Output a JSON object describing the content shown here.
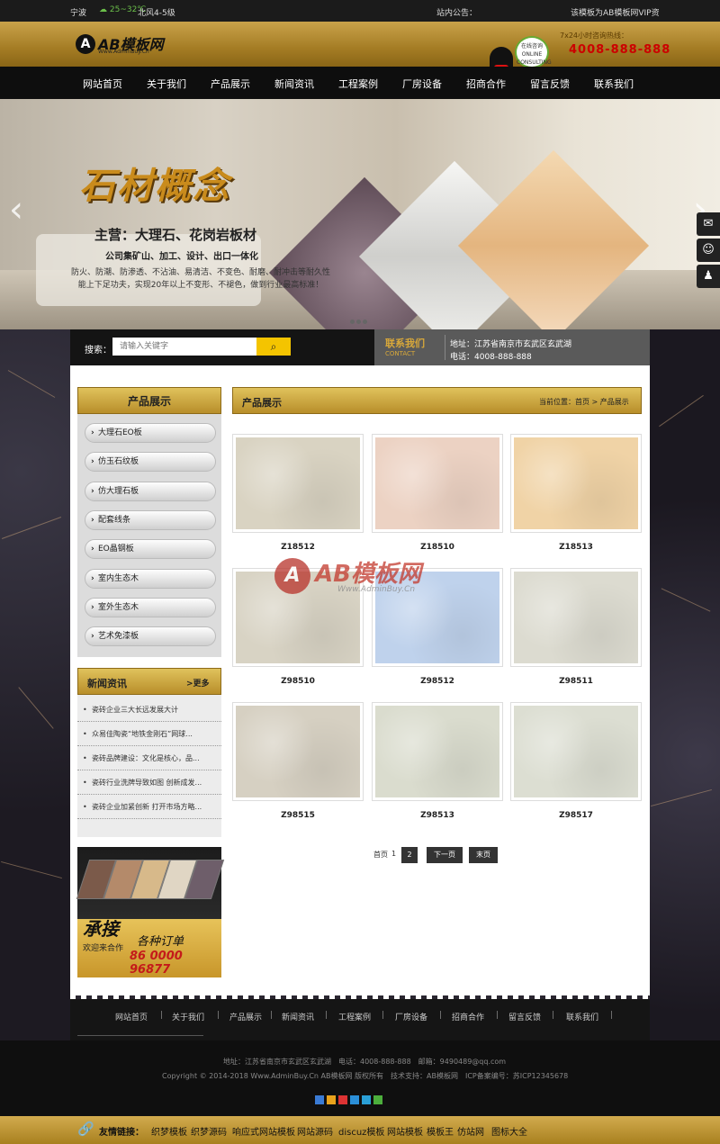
{
  "topbar": {
    "weixin": "宁波",
    "weather": "北风4-5级",
    "notice_label": "站内公告：",
    "notice_text": "该模板为AB模板网VIP资"
  },
  "header": {
    "logo_title": "AB模板网",
    "logo_sub": "Www.AdminBuy.Cn",
    "qq_bubble": "在线咨询 ONLINE CONSULTING",
    "hotline_label": "7x24小时咨询热线：",
    "hotline": "4008-888-888"
  },
  "nav": [
    "网站首页",
    "关于我们",
    "产品展示",
    "新闻资讯",
    "工程案例",
    "厂房设备",
    "招商合作",
    "留言反馈",
    "联系我们"
  ],
  "banner": {
    "title": "石材概念",
    "line1": "主营：大理石、花岗岩板材",
    "line2": "公司集矿山、加工、设计、出口一体化",
    "line3": "防火、防潮、防渗透、不沾油、易清洁、不变色、耐磨、耐冲击等耐久性能上下足功夫，实现20年以上不变形、不褪色，做到行业最高标准！"
  },
  "search": {
    "label": "搜索：",
    "placeholder": "请输入关键字"
  },
  "contact": {
    "title": "联系我们",
    "title_en": "CONTACT",
    "address": "地址：江苏省南京市玄武区玄武湖",
    "phone": "电话：4008-888-888"
  },
  "sidebar": {
    "products_title": "产品展示",
    "items": [
      "大理石EO板",
      "仿玉石纹板",
      "仿大理石板",
      "配套线条",
      "EO晶钢板",
      "室内生态木",
      "室外生态木",
      "艺术免漆板"
    ],
    "news_title": "新闻资讯",
    "news_more": ">更多",
    "news": [
      "瓷砖企业三大长远发展大计",
      "众易佳陶瓷“地铁金刚石”网球...",
      "瓷砖品牌建设：文化是核心，品...",
      "瓷砖行业洗牌导致如图 创新成发...",
      "瓷砖企业加紧创新 打开市场方略..."
    ],
    "ad": {
      "big": "承接",
      "small": "各种订单",
      "welcome": "欢迎来合作",
      "phone": "86 0000 96877"
    }
  },
  "content": {
    "title": "产品展示",
    "crumb": "当前位置：首页 > 产品展示",
    "products": [
      {
        "name": "Z18512",
        "color": "#d9d3c2"
      },
      {
        "name": "Z18510",
        "color": "#ecd2c3"
      },
      {
        "name": "Z18513",
        "color": "#f0d3a6"
      },
      {
        "name": "Z98510",
        "color": "#d8d3c4"
      },
      {
        "name": "Z98512",
        "color": "#bfd2ec"
      },
      {
        "name": "Z98511",
        "color": "#dcdbd0"
      },
      {
        "name": "Z98515",
        "color": "#d6d0c2"
      },
      {
        "name": "Z98513",
        "color": "#dadcce"
      },
      {
        "name": "Z98517",
        "color": "#dcded2"
      }
    ],
    "watermark": {
      "title": "AB模板网",
      "url": "Www.AdminBuy.Cn"
    },
    "pager": {
      "first": "首页",
      "current": "1",
      "page2": "2",
      "next": "下一页",
      "last": "末页"
    }
  },
  "footer_nav": [
    "网站首页",
    "关于我们",
    "产品展示",
    "新闻资讯",
    "工程案例",
    "厂房设备",
    "招商合作",
    "留言反馈",
    "联系我们"
  ],
  "footer": {
    "line1": "地址：江苏省南京市玄武区玄武湖　电话：4008-888-888　邮箱：9490489@qq.com",
    "line2": "Copyright © 2014-2018 Www.AdminBuy.Cn AB模板网 版权所有　技术支持：AB模板网　ICP备案编号：苏ICP12345678"
  },
  "links": {
    "label": "友情链接：",
    "items": [
      "织梦模板",
      "织梦源码",
      "响应式网站模板",
      "网站源码",
      "discuz模板",
      "网站模板",
      "模板王",
      "仿站网",
      "图标大全"
    ]
  }
}
